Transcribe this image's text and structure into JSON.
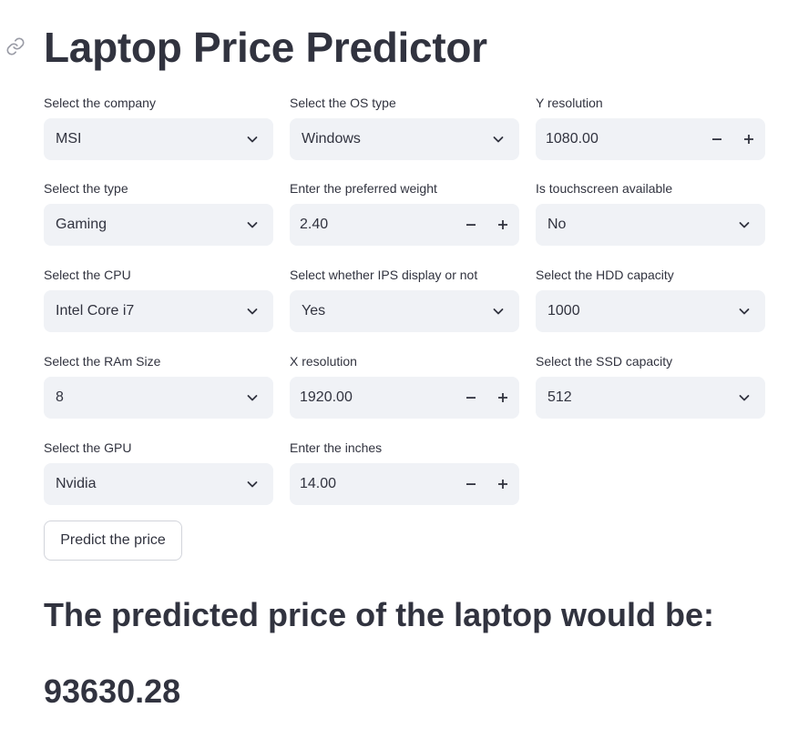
{
  "app": {
    "title": "Laptop Price Predictor"
  },
  "fields": {
    "company": {
      "label": "Select the company",
      "value": "MSI"
    },
    "os": {
      "label": "Select the OS type",
      "value": "Windows"
    },
    "y_resolution": {
      "label": "Y resolution",
      "value": "1080.00"
    },
    "type": {
      "label": "Select the type",
      "value": "Gaming"
    },
    "weight": {
      "label": "Enter the preferred weight",
      "value": "2.40"
    },
    "touchscreen": {
      "label": "Is touchscreen available",
      "value": "No"
    },
    "cpu": {
      "label": "Select the CPU",
      "value": "Intel Core i7"
    },
    "ips": {
      "label": "Select whether IPS display or not",
      "value": "Yes"
    },
    "hdd": {
      "label": "Select the HDD capacity",
      "value": "1000"
    },
    "ram": {
      "label": "Select the RAm Size",
      "value": "8"
    },
    "x_resolution": {
      "label": "X resolution",
      "value": "1920.00"
    },
    "ssd": {
      "label": "Select the SSD capacity",
      "value": "512"
    },
    "gpu": {
      "label": "Select the GPU",
      "value": "Nvidia"
    },
    "inches": {
      "label": "Enter the inches",
      "value": "14.00"
    }
  },
  "predict_button": {
    "label": "Predict the price"
  },
  "result": {
    "heading": "The predicted price of the laptop would be:",
    "value": "93630.28"
  },
  "icons": {
    "anchor": "link-icon",
    "dropdown": "chevron-down-icon",
    "decrement": "minus-icon",
    "increment": "plus-icon"
  },
  "colors": {
    "text": "#31333f",
    "input_bg": "#f0f2f6",
    "button_border": "#d2d4db",
    "background": "#ffffff"
  }
}
